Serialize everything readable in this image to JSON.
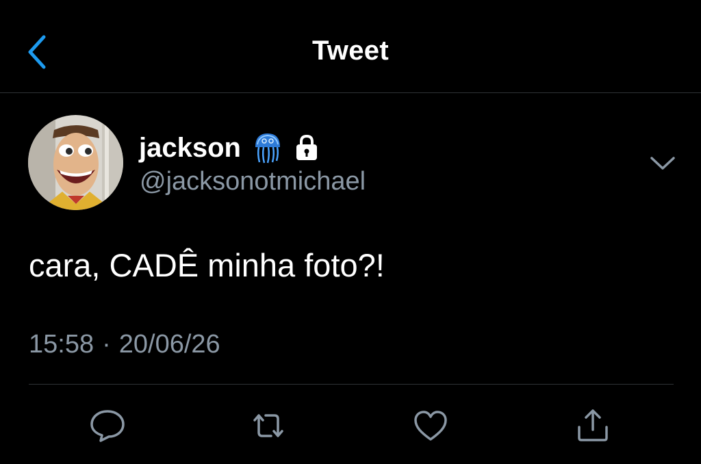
{
  "header": {
    "title": "Tweet",
    "back_icon": "back-chevron-icon",
    "accent_color": "#1d9bf0"
  },
  "tweet": {
    "author": {
      "display_name": "jackson",
      "handle": "@jacksonotmichael",
      "badges": [
        "jellyfish-emoji-icon",
        "lock-icon"
      ],
      "avatar": "avatar-cartoon-cowboy"
    },
    "text": "cara, CADÊ minha foto?!",
    "time": "15:58",
    "separator": "·",
    "date": "20/06/26"
  },
  "actions": [
    "reply-icon",
    "retweet-icon",
    "like-icon",
    "share-icon"
  ],
  "colors": {
    "background": "#000000",
    "text": "#ffffff",
    "secondary": "#8b98a5",
    "divider": "#2f3336"
  }
}
